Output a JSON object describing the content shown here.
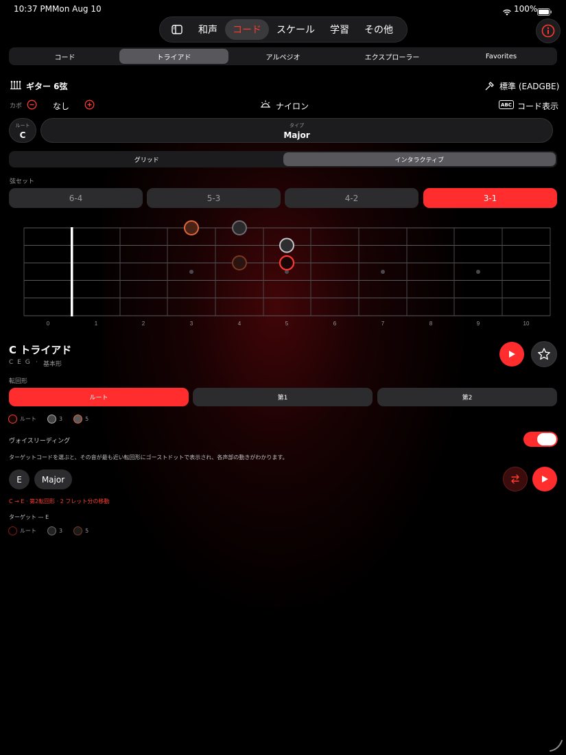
{
  "status": {
    "time": "10:37 PM",
    "date": "Mon Aug 10",
    "battery": "100%"
  },
  "topnav": {
    "items": [
      "和声",
      "コード",
      "スケール",
      "学習",
      "その他"
    ],
    "active": 1
  },
  "subtabs": {
    "items": [
      "コード",
      "トライアド",
      "アルペジオ",
      "エクスプローラー",
      "Favorites"
    ],
    "active": 1
  },
  "instrument": {
    "name": "ギター 6弦",
    "tuning": "標準 (EADGBE)"
  },
  "capo": {
    "label": "カポ",
    "value": "なし"
  },
  "string_type": "ナイロン",
  "chord_display": "コード表示",
  "root": {
    "label": "ルート",
    "value": "C"
  },
  "type": {
    "label": "タイプ",
    "value": "Major"
  },
  "view_modes": {
    "items": [
      "グリッド",
      "インタラクティブ"
    ],
    "active": 1
  },
  "string_set": {
    "label": "弦セット",
    "items": [
      "6-4",
      "5-3",
      "4-2",
      "3-1"
    ],
    "active": 3
  },
  "fretboard": {
    "fret_numbers": [
      "0",
      "1",
      "2",
      "3",
      "4",
      "5",
      "6",
      "7",
      "8",
      "9",
      "10"
    ]
  },
  "chord": {
    "title": "C トライアド",
    "notes": "C E G",
    "form": "基本形"
  },
  "inversions": {
    "label": "転回形",
    "items": [
      "ルート",
      "第1",
      "第2"
    ],
    "active": 0
  },
  "legend": {
    "items": [
      "ルート",
      "3",
      "5"
    ]
  },
  "voice_leading": {
    "label": "ヴォイスリーディング",
    "enabled": true,
    "description": "ターゲットコードを選ぶと、その音が最も近い転回形にゴーストドットで表示され、各声部の動きがわかります。",
    "target_root": "E",
    "target_type": "Major",
    "movement": "C → E · 第2転回形 · 2 フレット分の移動",
    "target_label": "ターゲット — E"
  },
  "colors": {
    "accent": "#ff2d2d",
    "root": "#ff3b30",
    "third": "#6e6e73",
    "fifth": "#c8582e"
  }
}
